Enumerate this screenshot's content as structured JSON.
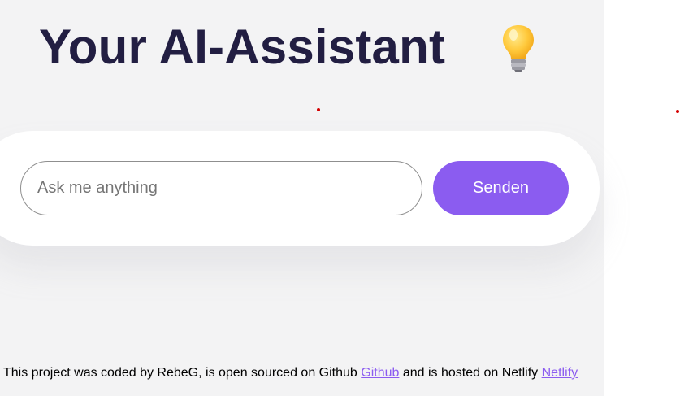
{
  "header": {
    "title": "Your AI-Assistant",
    "icon": "lightbulb-icon"
  },
  "search": {
    "placeholder": "Ask me anything",
    "value": ""
  },
  "send_button": {
    "label": "Senden"
  },
  "footer": {
    "text_part1": "This project was coded by RebeG, is open sourced on Github ",
    "github_link": "Github",
    "text_part2": " and is hosted on Netlify ",
    "netlify_link": "Netlify"
  },
  "colors": {
    "accent": "#8b5cf0",
    "title": "#221e42",
    "background": "#f3f3f4"
  }
}
